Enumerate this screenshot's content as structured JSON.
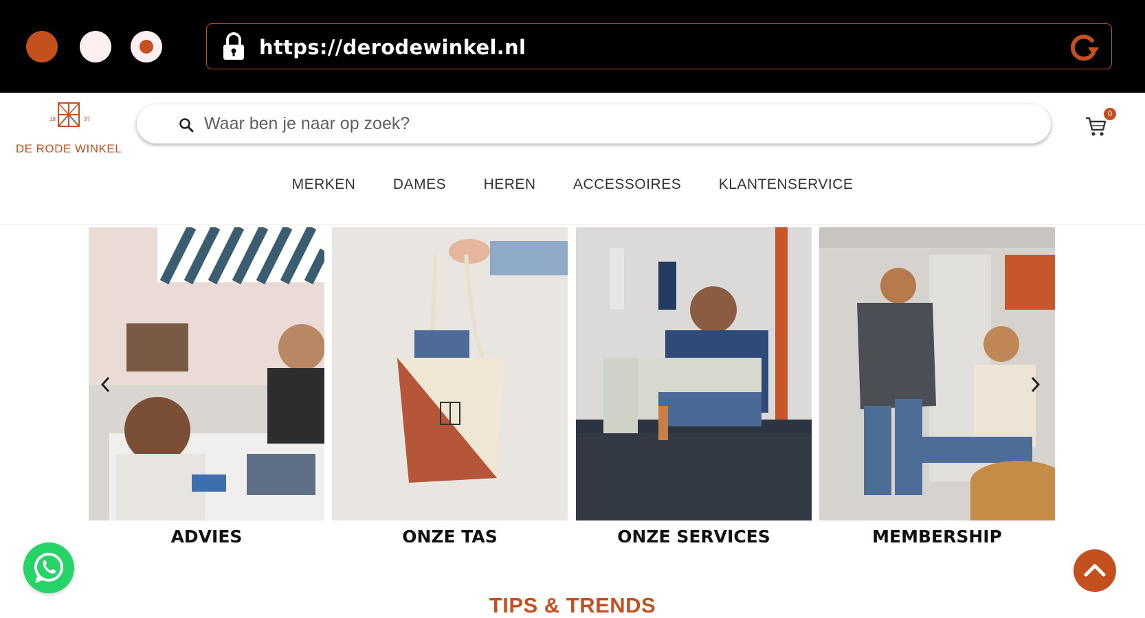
{
  "browser": {
    "url": "https://derodewinkel.nl"
  },
  "header": {
    "logo_text": "DE RODE WINKEL",
    "logo_year_left": "18",
    "logo_year_right": "37",
    "search_placeholder": "Waar ben je naar op zoek?",
    "cart_count": "0"
  },
  "nav": {
    "items": [
      "MERKEN",
      "DAMES",
      "HEREN",
      "ACCESSOIRES",
      "KLANTENSERVICE"
    ]
  },
  "tiles": [
    {
      "label": "ADVIES"
    },
    {
      "label": "ONZE TAS"
    },
    {
      "label": "ONZE SERVICES"
    },
    {
      "label": "MEMBERSHIP"
    }
  ],
  "section": {
    "title": "TIPS & TRENDS"
  },
  "colors": {
    "accent": "#c4501f",
    "whatsapp": "#25d366",
    "chrome": "#000000"
  }
}
